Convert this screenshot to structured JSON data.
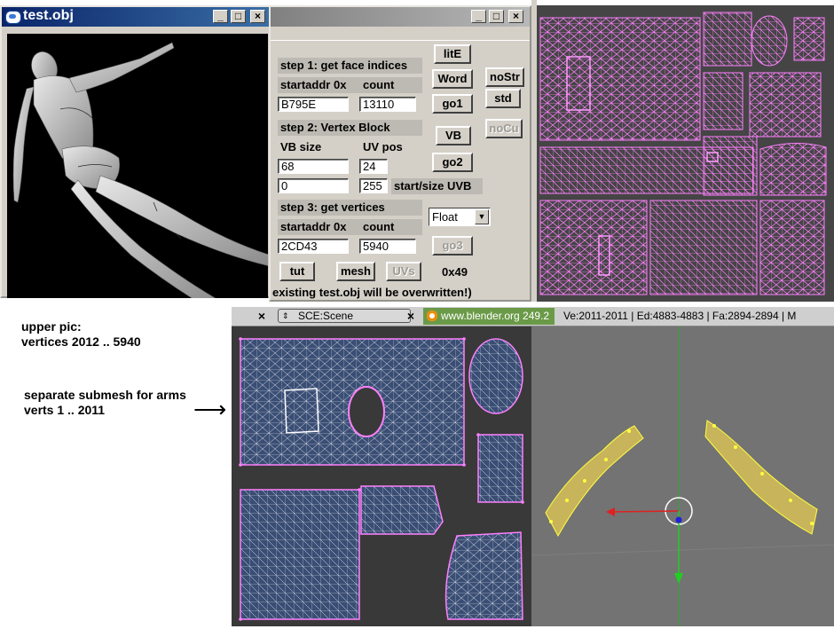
{
  "obj_window": {
    "title": "test.obj",
    "controls": {
      "minimize": "_",
      "maximize": "□",
      "close": "×"
    }
  },
  "tool_window": {
    "controls": {
      "minimize": "_",
      "maximize": "□",
      "close": "×"
    },
    "step1": {
      "heading": "step 1: get face indices",
      "startaddr_label": "startaddr 0x",
      "count_label": "count",
      "startaddr": "B795E",
      "count": "13110"
    },
    "step2": {
      "heading": "step 2: Vertex Block",
      "vbsize_label": "VB size",
      "uvpos_label": "UV pos",
      "vbsize": "68",
      "uvpos": "24",
      "uvb_start": "0",
      "uvb_size": "255",
      "uvb_label": "start/size UVB"
    },
    "step3": {
      "heading": "step 3: get vertices",
      "startaddr_label": "startaddr 0x",
      "count_label": "count",
      "startaddr": "2CD43",
      "count": "5940"
    },
    "format_select": "Float",
    "buttons": {
      "litE": "litE",
      "word": "Word",
      "go1": "go1",
      "noStr": "noStr",
      "std": "std",
      "noCu": "noCu",
      "vb": "VB",
      "go2": "go2",
      "go3": "go3",
      "tut": "tut",
      "mesh": "mesh",
      "uvs": "UVs"
    },
    "hex_readout": "0x49",
    "footer": "existing test.obj will be overwritten!)"
  },
  "blender_header": {
    "scene_label": "SCE:Scene",
    "version": "www.blender.org 249.2",
    "stats": "Ve:2011-2011 | Ed:4883-4883 | Fa:2894-2894 | M"
  },
  "notes": {
    "upper_pic_1": "upper pic:",
    "upper_pic_2": "vertices 2012 .. 5940",
    "submesh_1": "separate submesh for arms",
    "submesh_2": "verts 1 .. 2011",
    "arrow": "⟶"
  },
  "colors": {
    "uv_wire": "#ff80ff",
    "uv_face": "#3a4e75",
    "mesh_select": "#ffff40",
    "titlebar": "#0a246a"
  }
}
